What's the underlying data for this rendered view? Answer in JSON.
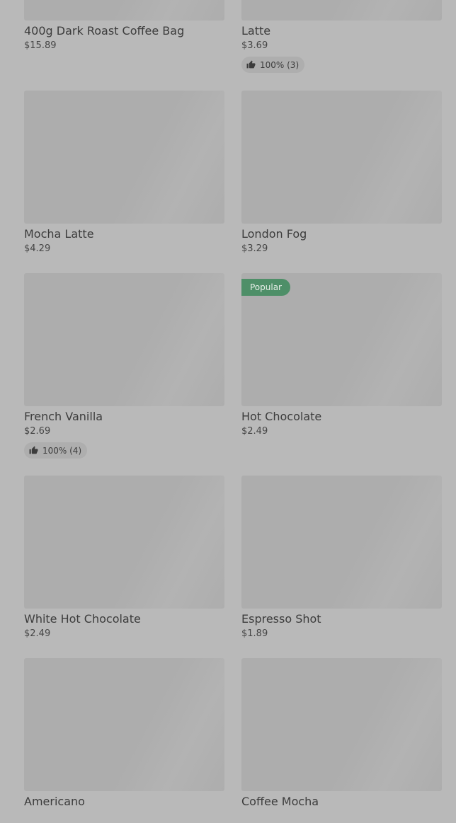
{
  "colors": {
    "page_background": "#b9b9b9",
    "image_placeholder": "#adadad",
    "badge_background": "#4e8f68",
    "rating_pill_background": "#aeaeae",
    "text": "#3c3c3c"
  },
  "products": [
    {
      "name": "400g Dark Roast Coffee Bag",
      "price": "$15.89",
      "badge": null,
      "rating": null
    },
    {
      "name": "Latte",
      "price": "$3.69",
      "badge": null,
      "rating": "100% (3)"
    },
    {
      "name": "Mocha Latte",
      "price": "$4.29",
      "badge": null,
      "rating": null
    },
    {
      "name": "London Fog",
      "price": "$3.29",
      "badge": null,
      "rating": null
    },
    {
      "name": "French Vanilla",
      "price": "$2.69",
      "badge": null,
      "rating": "100% (4)"
    },
    {
      "name": "Hot Chocolate",
      "price": "$2.49",
      "badge": "Popular",
      "rating": null
    },
    {
      "name": "White Hot Chocolate",
      "price": "$2.49",
      "badge": null,
      "rating": null
    },
    {
      "name": "Espresso Shot",
      "price": "$1.89",
      "badge": null,
      "rating": null
    },
    {
      "name": "Americano",
      "price": "",
      "badge": null,
      "rating": null
    },
    {
      "name": "Coffee Mocha",
      "price": "",
      "badge": null,
      "rating": null
    }
  ]
}
